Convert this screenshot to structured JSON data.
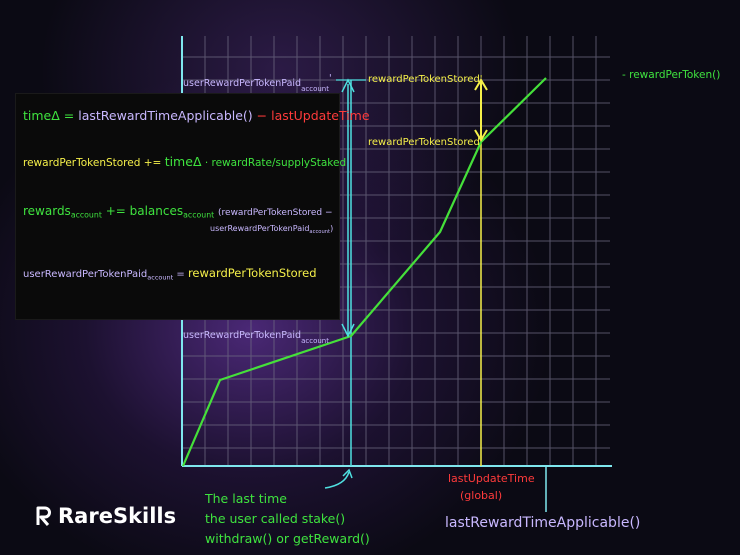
{
  "formulas": {
    "line1": {
      "lhs": "time",
      "delta": "Δ",
      "eq": " = ",
      "applicable": "lastRewardTimeApplicable()",
      "minus": " − ",
      "last_update": "lastUpdateTime"
    },
    "line2": {
      "lhs": "rewardPerTokenStored",
      "op": " += ",
      "time": "time",
      "delta": "Δ",
      "dot": " · ",
      "rate": "rewardRate/supplyStaked"
    },
    "line3": {
      "lhs": "rewards",
      "sub": "account",
      "op": " += ",
      "balances": "balances",
      "bal_sub": "account",
      "rhs_a": "(rewardPerTokenStored −",
      "rhs_b": "userRewardPerTokenPaid",
      "rhs_b_sub": "account",
      "rhs_b_close": ")"
    },
    "line4": {
      "lhs": "userRewardPerTokenPaid",
      "sub": "account",
      "op": " = ",
      "rhs": "rewardPerTokenStored"
    }
  },
  "labels": {
    "paid_prime": "userRewardPerTokenPaid",
    "paid_prime_sub": "account",
    "paid_prime_mark": "'",
    "paid": "userRewardPerTokenPaid",
    "paid_sub": "account",
    "stored_prime": "rewardPerTokenStored'",
    "stored": "rewardPerTokenStored",
    "legend": "- rewardPerToken()",
    "last_update": "lastUpdateTime",
    "global": "(global)",
    "x_axis": "lastRewardTimeApplicable()",
    "note_1": "The last time",
    "note_2": "the user called stake()",
    "note_3": "withdraw() or getReward()"
  },
  "brand": {
    "name": "RareSkills"
  },
  "colors": {
    "grid": "#6e6a82",
    "axis": "#7fe7ee",
    "line": "#45e03a",
    "yellow": "#f5f04a",
    "red": "#ff3b3b",
    "cyan": "#4fe0e0",
    "lilac": "#c9b8ff",
    "green_text": "#3fe33f"
  },
  "icons": [
    "up-down-arrow-icon",
    "curved-arrow-icon",
    "rareskills-logo-icon"
  ]
}
